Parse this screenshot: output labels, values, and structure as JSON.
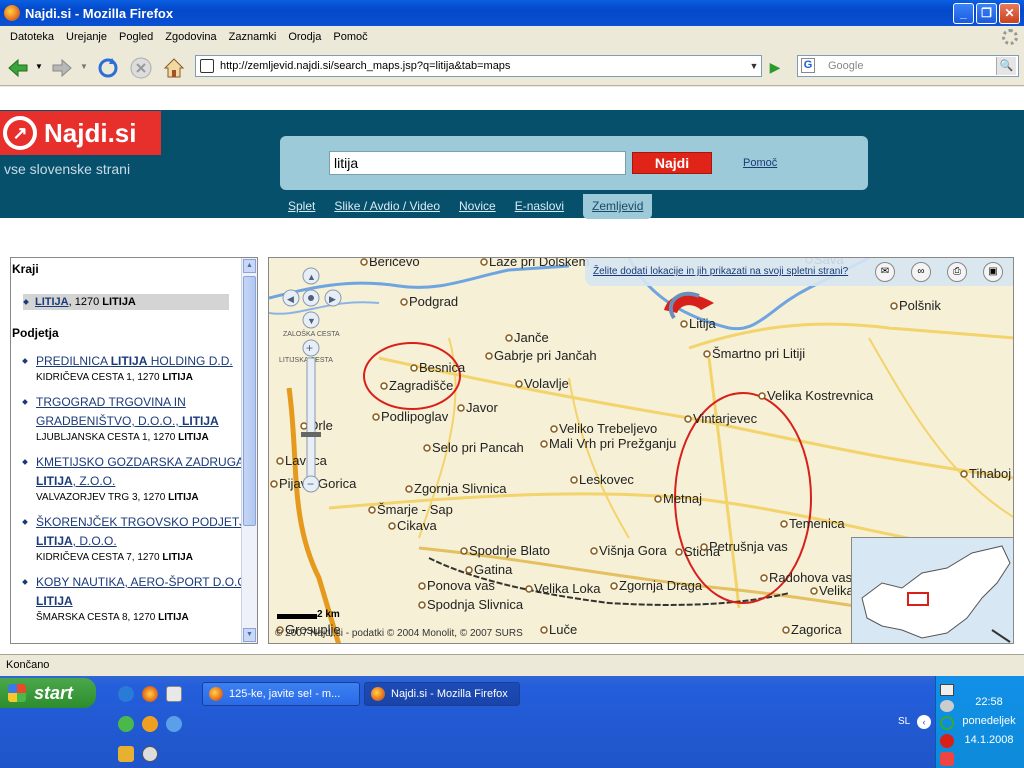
{
  "window": {
    "title": "Najdi.si - Mozilla Firefox"
  },
  "menu": [
    "Datoteka",
    "Urejanje",
    "Pogled",
    "Zgodovina",
    "Zaznamki",
    "Orodja",
    "Pomoč"
  ],
  "address": {
    "url": "http://zemljevid.najdi.si/search_maps.jsp?q=litija&tab=maps"
  },
  "google_search": {
    "placeholder": "Google"
  },
  "site": {
    "logo": "Najdi.si",
    "tagline": "vse slovenske strani",
    "search_value": "litija",
    "search_button": "Najdi",
    "help": "Pomoč",
    "tabs": [
      "Splet",
      "Slike / Avdio / Video",
      "Novice",
      "E-naslovi",
      "Zemljevid"
    ],
    "active_tab": "Zemljevid"
  },
  "results": {
    "kraji_title": "Kraji",
    "kraj": {
      "name": "LITIJA",
      "rest": ", 1270 ",
      "city": "LITIJA"
    },
    "podjetja_title": "Podjetja",
    "companies": [
      {
        "name1": "PREDILNICA ",
        "bold": "LITIJA",
        "name2": " HOLDING D.D.",
        "addr": "KIDRIČEVA CESTA 1, 1270 ",
        "city": "LITIJA"
      },
      {
        "name1": "TRGOGRAD TRGOVINA IN GRADBENIŠTVO, D.O.O., ",
        "bold": "LITIJA",
        "name2": "",
        "addr": "LJUBLJANSKA CESTA 1, 1270 ",
        "city": "LITIJA"
      },
      {
        "name1": "KMETIJSKO GOZDARSKA ZADRUGA ",
        "bold": "LITIJA",
        "name2": ", Z.O.O.",
        "addr": "VALVAZORJEV TRG 3, 1270 ",
        "city": "LITIJA"
      },
      {
        "name1": "ŠKORENJČEK TRGOVSKO PODJETJE ",
        "bold": "LITIJA",
        "name2": ", D.O.O.",
        "addr": "KIDRIČEVA CESTA 7, 1270 ",
        "city": "LITIJA"
      },
      {
        "name1": "KOBY NAUTIKA, AERO-ŠPORT D.O.O., ",
        "bold": "LITIJA",
        "name2": "",
        "addr": "ŠMARSKA CESTA 8, 1270 ",
        "city": "LITIJA"
      }
    ]
  },
  "map": {
    "banner": "Želite dodati lokacije in jih prikazati na svoji spletni strani?",
    "scale": "2 km",
    "copyright": "© 2007 Najdi.si - podatki © 2004 Monolit, © 2007 SURS",
    "river_labels": [
      "ZALOŠKA CESTA",
      "LITIJSKA CESTA"
    ],
    "places": [
      {
        "name": "Beričevo"
      },
      {
        "name": "Laze pri Dolskem"
      },
      {
        "name": "Sava"
      },
      {
        "name": "Podgrad"
      },
      {
        "name": "Litija"
      },
      {
        "name": "Polšnik"
      },
      {
        "name": "Janče"
      },
      {
        "name": "Gabrje pri Jančah"
      },
      {
        "name": "Šmartno pri Litiji"
      },
      {
        "name": "Besnica"
      },
      {
        "name": "Zagradišče"
      },
      {
        "name": "Volavlje"
      },
      {
        "name": "Velika Kostrevnica"
      },
      {
        "name": "Javor"
      },
      {
        "name": "Podlipoglav"
      },
      {
        "name": "Vintarjevec"
      },
      {
        "name": "Drle"
      },
      {
        "name": "Veliko Trebeljevo"
      },
      {
        "name": "Selo pri Pancah"
      },
      {
        "name": "Mali Vrh pri Prežganju"
      },
      {
        "name": "Lavrica"
      },
      {
        "name": "Leskovec"
      },
      {
        "name": "Tihaboj"
      },
      {
        "name": "Pijava Gorica"
      },
      {
        "name": "Zgornja Slivnica"
      },
      {
        "name": "Metnaj"
      },
      {
        "name": "Šmarje - Sap"
      },
      {
        "name": "Temenica"
      },
      {
        "name": "Cikava"
      },
      {
        "name": "Spodnje Blato"
      },
      {
        "name": "Višnja Gora"
      },
      {
        "name": "Stična"
      },
      {
        "name": "Petrušnja vas"
      },
      {
        "name": "Gatina"
      },
      {
        "name": "Radohova vas"
      },
      {
        "name": "Ponova vas"
      },
      {
        "name": "Velika Loka"
      },
      {
        "name": "Zgornja Draga"
      },
      {
        "name": "Velika"
      },
      {
        "name": "Spodnja Slivnica"
      },
      {
        "name": "Luče"
      },
      {
        "name": "Zagorica"
      },
      {
        "name": "Grosuplje"
      }
    ]
  },
  "status": "Končano",
  "taskbar": {
    "start": "start",
    "tasks": [
      "125-ke, javite se! - m...",
      "Najdi.si - Mozilla Firefox"
    ],
    "lang": "SL",
    "time": "22:58",
    "day": "ponedeljek",
    "date": "14.1.2008"
  }
}
